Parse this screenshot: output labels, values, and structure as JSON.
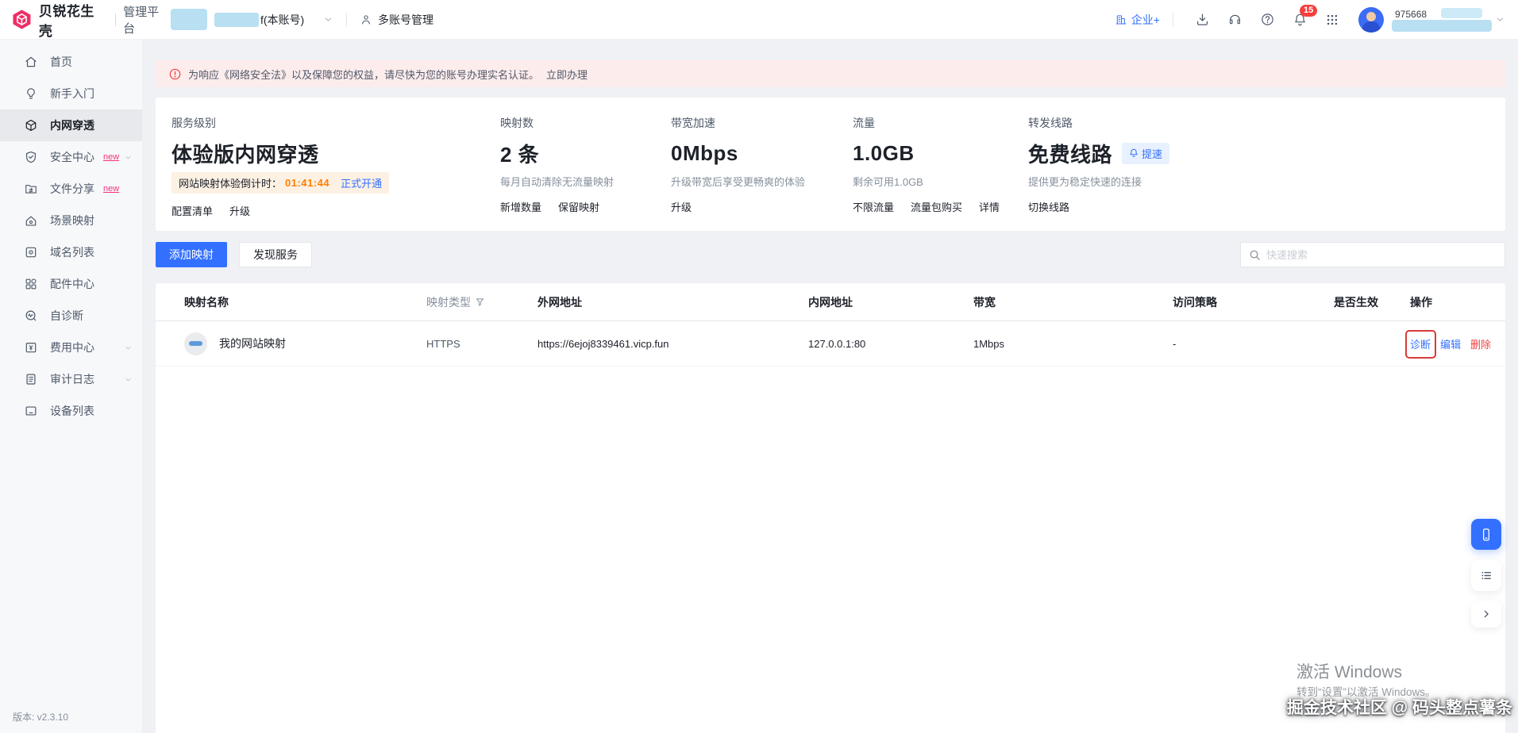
{
  "colors": {
    "primary": "#3370ff",
    "brand": "#ee2e65",
    "danger": "#f53f3f",
    "warning": "#ff7d00"
  },
  "topbar": {
    "brand": "贝锐花生壳",
    "product": "管理平台",
    "account_label": "f(本账号)",
    "multi_account": "多账号管理",
    "enterprise": "企业+",
    "notification_count": "15",
    "username": "975668"
  },
  "sidebar": {
    "items": [
      {
        "label": "首页"
      },
      {
        "label": "新手入门"
      },
      {
        "label": "内网穿透"
      },
      {
        "label": "安全中心",
        "badge": "new"
      },
      {
        "label": "文件分享",
        "badge": "new"
      },
      {
        "label": "场景映射"
      },
      {
        "label": "域名列表"
      },
      {
        "label": "配件中心"
      },
      {
        "label": "自诊断"
      },
      {
        "label": "费用中心"
      },
      {
        "label": "审计日志"
      },
      {
        "label": "设备列表"
      }
    ],
    "version": "版本:  v2.3.10"
  },
  "alert": {
    "text": "为响应《网络安全法》以及保障您的权益，请尽快为您的账号办理实名认证。",
    "action": "立即办理"
  },
  "overview": {
    "service": {
      "label": "服务级别",
      "value": "体验版内网穿透",
      "countdown_label": "网站映射体验倒计时：",
      "countdown_time": "01:41:44",
      "countdown_action": "正式开通",
      "links": [
        "配置清单",
        "升级"
      ]
    },
    "mappings": {
      "label": "映射数",
      "value": "2 条",
      "desc": "每月自动清除无流量映射",
      "links": [
        "新增数量",
        "保留映射"
      ]
    },
    "bandwidth": {
      "label": "带宽加速",
      "value": "0Mbps",
      "desc": "升级带宽后享受更畅爽的体验",
      "links": [
        "升级"
      ]
    },
    "traffic": {
      "label": "流量",
      "value": "1.0GB",
      "desc": "剩余可用1.0GB",
      "links": [
        "不限流量",
        "流量包购买",
        "详情"
      ]
    },
    "route": {
      "label": "转发线路",
      "value": "免费线路",
      "badge": "提速",
      "desc": "提供更为稳定快速的连接",
      "links": [
        "切换线路"
      ]
    }
  },
  "toolbar": {
    "add_mapping": "添加映射",
    "discover": "发现服务",
    "search_placeholder": "快速搜索"
  },
  "table": {
    "headers": [
      "映射名称",
      "映射类型",
      "外网地址",
      "内网地址",
      "带宽",
      "访问策略",
      "是否生效",
      "操作"
    ],
    "row": {
      "name": "我的网站映射",
      "type": "HTTPS",
      "external": "https://6ejoj8339461.vicp.fun",
      "internal": "127.0.0.1:80",
      "bandwidth": "1Mbps",
      "policy": "-",
      "active": true,
      "actions": [
        "诊断",
        "编辑",
        "删除"
      ]
    }
  },
  "watermark": {
    "activate": "激活 Windows",
    "hint": "转到“设置”以激活 Windows。",
    "credit": "掘金技术社区 @ 码头整点薯条"
  }
}
